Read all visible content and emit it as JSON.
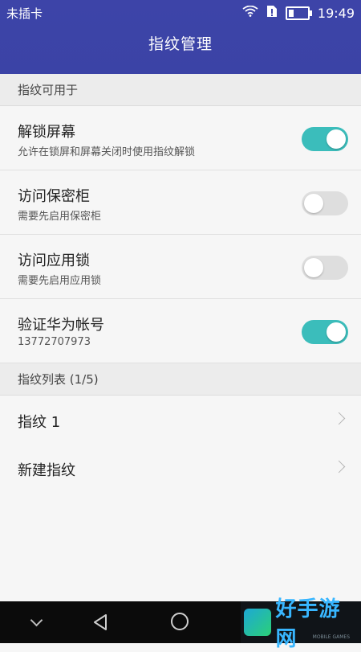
{
  "status_bar": {
    "carrier": "未插卡",
    "time": "19:49",
    "icons": [
      "wifi-icon",
      "sim-icon",
      "battery-icon"
    ]
  },
  "header": {
    "title": "指纹管理"
  },
  "colors": {
    "header": "#3d44a8",
    "accent": "#3bbdbb"
  },
  "section_usage": {
    "label": "指纹可用于"
  },
  "settings": [
    {
      "title": "解锁屏幕",
      "subtitle": "允许在锁屏和屏幕关闭时使用指纹解锁",
      "enabled": true
    },
    {
      "title": "访问保密柜",
      "subtitle": "需要先启用保密柜",
      "enabled": false
    },
    {
      "title": "访问应用锁",
      "subtitle": "需要先启用应用锁",
      "enabled": false
    },
    {
      "title": "验证华为帐号",
      "subtitle": "13772707973",
      "enabled": true
    }
  ],
  "section_list": {
    "label": "指纹列表 (1/5)"
  },
  "fingerprints": [
    {
      "label": "指纹 1"
    },
    {
      "label": "新建指纹"
    }
  ],
  "navbar": {
    "buttons": [
      "chevron-down-icon",
      "back-icon",
      "home-icon"
    ]
  },
  "watermark": {
    "text": "好手游网",
    "subtext": "MOBILE GAMES"
  }
}
